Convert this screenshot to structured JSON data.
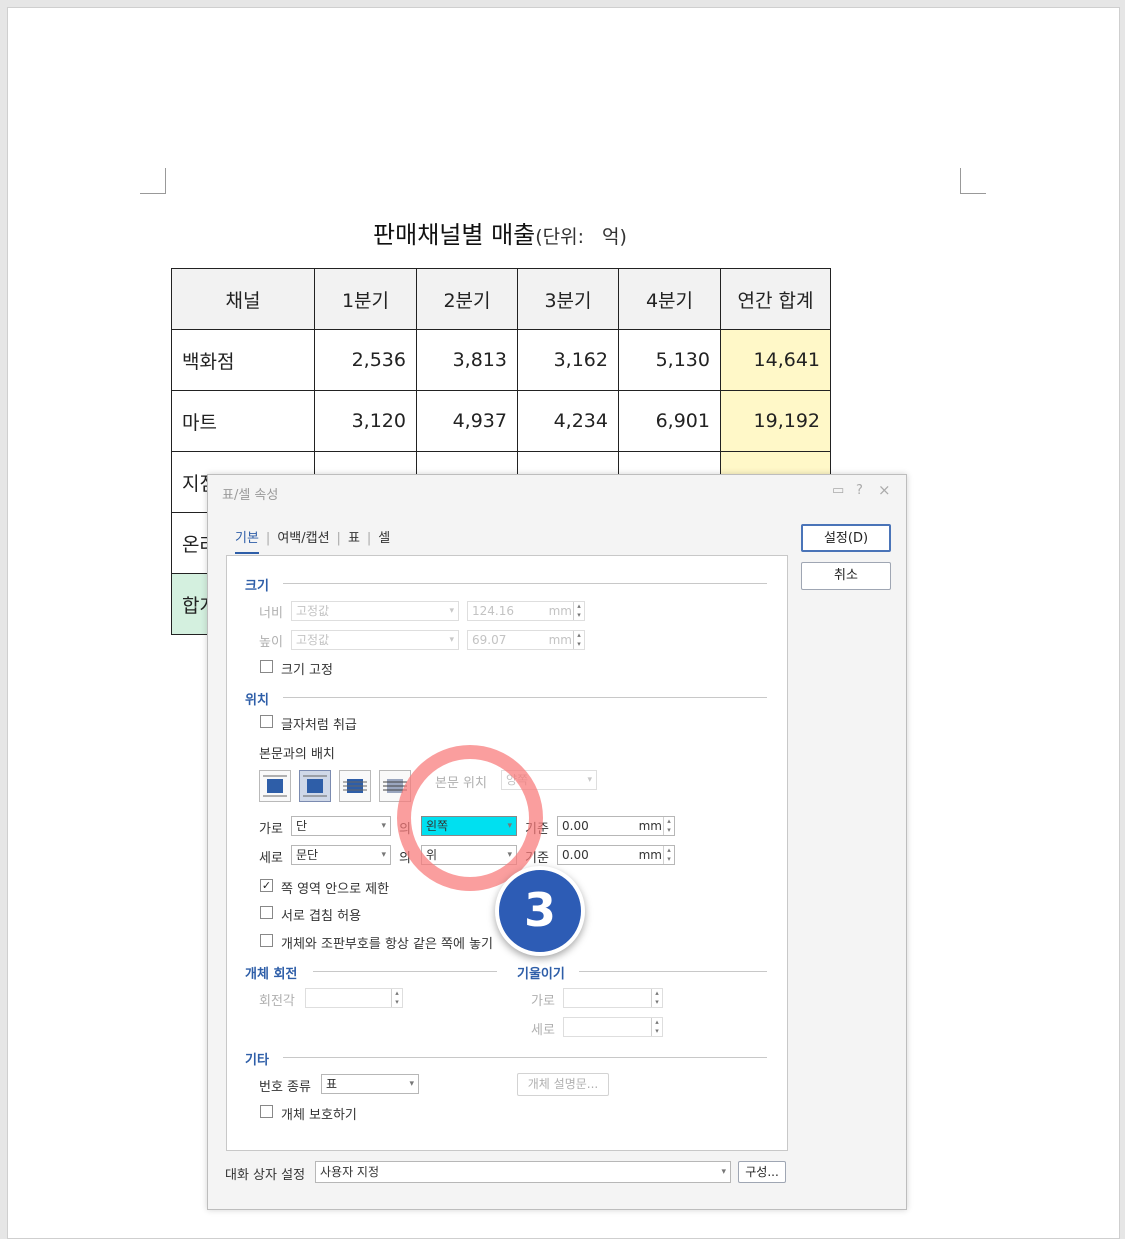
{
  "document": {
    "title": "판매채널별 매출",
    "unit_prefix": "(단위:",
    "unit_value": "억)",
    "table": {
      "headers": [
        "채널",
        "1분기",
        "2분기",
        "3분기",
        "4분기",
        "연간 합계"
      ],
      "rows": [
        {
          "name": "백화점",
          "values": [
            "2,536",
            "3,813",
            "3,162",
            "5,130"
          ],
          "total": "14,641"
        },
        {
          "name": "마트",
          "values": [
            "3,120",
            "4,937",
            "4,234",
            "6,901"
          ],
          "total": "19,192"
        },
        {
          "name": "지점",
          "values": [
            "",
            "",
            "",
            ""
          ],
          "total": ""
        },
        {
          "name": "온라인",
          "values": [
            "",
            "",
            "",
            ""
          ],
          "total": ""
        },
        {
          "name": "합계",
          "values": [
            "",
            "",
            "",
            ""
          ],
          "total": ""
        }
      ]
    }
  },
  "dialog": {
    "title": "표/셀 속성",
    "controls": {
      "restore": "▭",
      "help": "?",
      "close": "×"
    },
    "tabs": [
      "기본",
      "여백/캡션",
      "표",
      "셀"
    ],
    "ok_label": "설정(D)",
    "cancel_label": "취소",
    "size": {
      "section": "크기",
      "width_label": "너비",
      "width_mode": "고정값",
      "width_value": "124.16",
      "height_label": "높이",
      "height_mode": "고정값",
      "height_value": "69.07",
      "unit": "mm",
      "fix_size": "크기 고정"
    },
    "position": {
      "section": "위치",
      "treat_as_char": "글자처럼 취급",
      "wrap_label": "본문과의 배치",
      "body_pos_label": "본문 위치",
      "body_pos_value": "양쪽",
      "horiz_label": "가로",
      "horiz_ref": "단",
      "of": "의",
      "horiz_align": "왼쪽",
      "base": "기준",
      "horiz_offset": "0.00",
      "vert_label": "세로",
      "vert_ref": "문단",
      "vert_align": "위",
      "vert_offset": "0.00",
      "unit": "mm",
      "limit_page": "쪽 영역 안으로 제한",
      "allow_overlap": "서로 겹침 허용",
      "same_page": "개체와 조판부호를 항상 같은 쪽에 놓기"
    },
    "rotation": {
      "section": "개체 회전",
      "angle_label": "회전각"
    },
    "skew": {
      "section": "기울이기",
      "horiz_label": "가로",
      "vert_label": "세로"
    },
    "etc": {
      "section": "기타",
      "number_type_label": "번호 종류",
      "number_type_value": "표",
      "desc_button": "개체 설명문...",
      "protect": "개체 보호하기"
    },
    "footer": {
      "label": "대화 상자 설정",
      "value": "사용자 지정",
      "config_button": "구성..."
    }
  },
  "annotation": {
    "step": "3",
    "ring_color": "#f87878",
    "badge_color": "#2d5cb5"
  },
  "colors": {
    "accent": "#2e5ea8",
    "highlight": "#00e0f0",
    "total_fill": "#fff8c8",
    "sum_fill": "#d4f0df"
  }
}
